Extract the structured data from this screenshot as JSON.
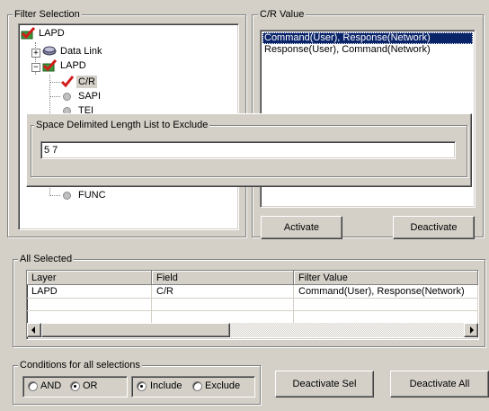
{
  "filter_selection": {
    "title": "Filter Selection",
    "tree": [
      {
        "label": "LAPD",
        "icon": "checked-filter-icon"
      },
      {
        "label": "Data Link",
        "icon": "link-icon"
      },
      {
        "label": "LAPD",
        "icon": "checked-filter-icon"
      },
      {
        "label": "C/R",
        "icon": "checkmark-icon"
      },
      {
        "label": "SAPI",
        "icon": "field-ball-icon"
      },
      {
        "label": "TEI",
        "icon": "field-ball-icon"
      },
      {
        "label": "FUNC",
        "icon": "field-ball-icon"
      }
    ]
  },
  "cr_value": {
    "title": "C/R Value",
    "items": [
      "Command(User), Response(Network)",
      "Response(User), Command(Network)"
    ],
    "activate_label": "Activate",
    "deactivate_label": "Deactivate"
  },
  "exclude_popup": {
    "title": "Space Delimited Length List to Exclude",
    "value": "5 7"
  },
  "all_selected": {
    "title": "All Selected",
    "columns": [
      "Layer",
      "Field",
      "Filter Value"
    ],
    "rows": [
      [
        "LAPD",
        "C/R",
        "Command(User), Response(Network)"
      ]
    ]
  },
  "conditions": {
    "title": "Conditions for all selections",
    "and_label": "AND",
    "or_label": "OR",
    "include_label": "Include",
    "exclude_label": "Exclude",
    "and_or_selected": "OR",
    "include_exclude_selected": "Include"
  },
  "buttons": {
    "deactivate_sel": "Deactivate Sel",
    "deactivate_all": "Deactivate All"
  },
  "colors": {
    "selection": "#0a246a",
    "check_red": "#d21b1b",
    "check_green": "#2e9a2e"
  }
}
